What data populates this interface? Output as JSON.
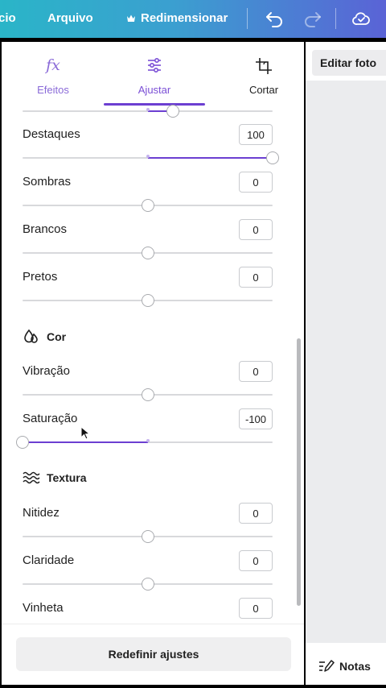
{
  "topbar": {
    "home_partial": "cio",
    "file_label": "Arquivo",
    "resize_label": "Redimensionar",
    "icons": [
      "crown-icon",
      "undo-icon",
      "redo-icon",
      "cloud-check-icon"
    ]
  },
  "tabs": [
    {
      "label": "Efeitos",
      "icon": "fx-icon",
      "active": false
    },
    {
      "label": "Ajustar",
      "icon": "sliders-icon",
      "active": true
    },
    {
      "label": "Cortar",
      "icon": "crop-icon",
      "active": false
    }
  ],
  "adjustments": [
    {
      "label": "Destaques",
      "value": "100",
      "level": 100
    },
    {
      "label": "Sombras",
      "value": "0",
      "level": 0
    },
    {
      "label": "Brancos",
      "value": "0",
      "level": 0
    },
    {
      "label": "Pretos",
      "value": "0",
      "level": 0
    }
  ],
  "color_section": {
    "title": "Cor",
    "icon": "color-drops-icon",
    "items": [
      {
        "label": "Vibração",
        "value": "0",
        "level": 0
      },
      {
        "label": "Saturação",
        "value": "-100",
        "level": -100
      }
    ]
  },
  "texture_section": {
    "title": "Textura",
    "icon": "waves-icon",
    "items": [
      {
        "label": "Nitidez",
        "value": "0",
        "level": 0
      },
      {
        "label": "Claridade",
        "value": "0",
        "level": 0
      },
      {
        "label": "Vinheta",
        "value": "0",
        "level": 0
      }
    ]
  },
  "partial_top_slider_level": 20,
  "reset_label": "Redefinir ajustes",
  "right_panel": {
    "edit_photo_label": "Editar foto",
    "notes_label": "Notas"
  },
  "colors": {
    "accent": "#6c3fd1",
    "topbar_start": "#2ab5c8",
    "topbar_end": "#5a63d6"
  }
}
